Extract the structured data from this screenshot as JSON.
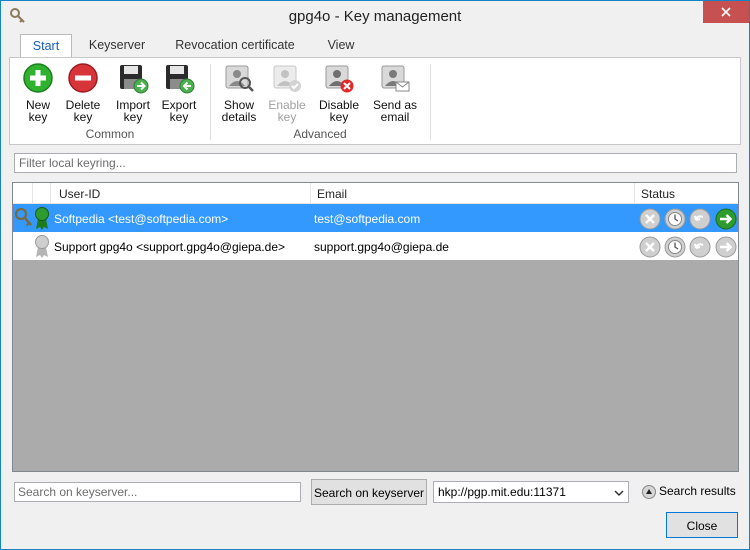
{
  "window": {
    "title": "gpg4o - Key management"
  },
  "tabs": [
    {
      "label": "Start",
      "active": true
    },
    {
      "label": "Keyserver"
    },
    {
      "label": "Revocation certificate"
    },
    {
      "label": "View"
    }
  ],
  "ribbon": {
    "groups": {
      "common": "Common",
      "advanced": "Advanced"
    },
    "buttons": {
      "new_key": "New\nkey",
      "delete_key": "Delete\nkey",
      "import_key": "Import\nkey",
      "export_key": "Export\nkey",
      "show_details": "Show\ndetails",
      "enable_key": "Enable\nkey",
      "disable_key": "Disable\nkey",
      "send_email": "Send as\nemail"
    }
  },
  "filter": {
    "placeholder": "Filter local keyring..."
  },
  "list": {
    "columns": {
      "user_id": "User-ID",
      "email": "Email",
      "status": "Status"
    },
    "rows": [
      {
        "user_id": "Softpedia <test@softpedia.com>",
        "email": "test@softpedia.com",
        "selected": true
      },
      {
        "user_id": "Support gpg4o <support.gpg4o@giepa.de>",
        "email": "support.gpg4o@giepa.de",
        "selected": false
      }
    ]
  },
  "keyserver": {
    "search_placeholder": "Search on keyserver...",
    "search_button": "Search on keyserver",
    "selected_server": "hkp://pgp.mit.edu:11371",
    "results_label": "Search results"
  },
  "footer": {
    "close": "Close"
  },
  "colors": {
    "selection": "#3399ff",
    "accent": "#1a5fb4",
    "list_bg": "#ababab"
  }
}
